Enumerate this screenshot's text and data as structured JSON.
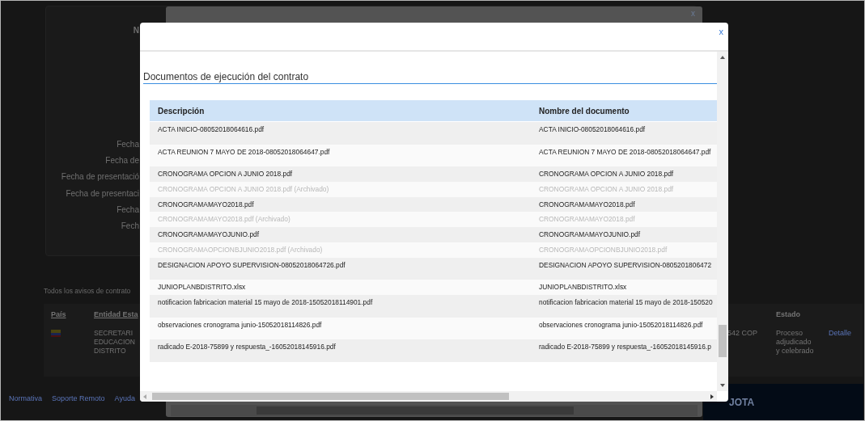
{
  "background_page": {
    "form_labels": [
      "N",
      "Fecha",
      "Fecha de",
      "Fecha de presentació",
      "Fecha de presentaci",
      "Fecha",
      "Fech"
    ],
    "notices_heading": "Todos los avisos de contrato",
    "results_table": {
      "column_1": "País",
      "column_2": "Entidad Esta",
      "status_header": "Estado",
      "row": {
        "entity_lines": [
          "SECRETARI",
          "EDUCACION",
          "DISTRITO"
        ],
        "value": "542 COP",
        "status": "Proceso adjudicado y celebrado",
        "link": "Detalle"
      }
    },
    "footer_links": [
      "Normativa",
      "Soporte Remoto",
      "Ayuda"
    ],
    "banner_text": "JOTA"
  },
  "back_dialog": {
    "close": "x"
  },
  "dialog": {
    "close": "x",
    "section_title": "Documentos de ejecución del contrato",
    "table": {
      "columns": [
        "Descripción",
        "Nombre del documento"
      ],
      "rows": [
        {
          "description": "ACTA INICIO-08052018064616.pdf",
          "document_name": "ACTA INICIO-08052018064616.pdf",
          "archived": false,
          "tall": true
        },
        {
          "description": "ACTA REUNION 7 MAYO DE 2018-08052018064647.pdf",
          "document_name": "ACTA REUNION 7 MAYO DE 2018-08052018064647.pdf",
          "archived": false,
          "tall": true
        },
        {
          "description": "CRONOGRAMA OPCION A JUNIO 2018.pdf",
          "document_name": "CRONOGRAMA OPCION A JUNIO 2018.pdf",
          "archived": false,
          "tall": false
        },
        {
          "description": "CRONOGRAMA OPCION A JUNIO 2018.pdf (Archivado)",
          "document_name": "CRONOGRAMA OPCION A JUNIO 2018.pdf",
          "archived": true,
          "tall": false
        },
        {
          "description": "CRONOGRAMAMAYO2018.pdf",
          "document_name": "CRONOGRAMAMAYO2018.pdf",
          "archived": false,
          "tall": false
        },
        {
          "description": "CRONOGRAMAMAYO2018.pdf (Archivado)",
          "document_name": "CRONOGRAMAMAYO2018.pdf",
          "archived": true,
          "tall": false
        },
        {
          "description": "CRONOGRAMAMAYOJUNIO.pdf",
          "document_name": "CRONOGRAMAMAYOJUNIO.pdf",
          "archived": false,
          "tall": false
        },
        {
          "description": "CRONOGRAMAOPCIONBJUNIO2018.pdf (Archivado)",
          "document_name": "CRONOGRAMAOPCIONBJUNIO2018.pdf",
          "archived": true,
          "tall": false
        },
        {
          "description": "DESIGNACION APOYO SUPERVISION-08052018064726.pdf",
          "document_name": "DESIGNACION APOYO SUPERVISION-0805201806472",
          "archived": false,
          "tall": true
        },
        {
          "description": "JUNIOPLANBDISTRITO.xlsx",
          "document_name": "JUNIOPLANBDISTRITO.xlsx",
          "archived": false,
          "tall": false
        },
        {
          "description": "notificacion fabricacion material 15 mayo de 2018-15052018114901.pdf",
          "document_name": "notificacion fabricacion material 15 mayo de 2018-150520",
          "archived": false,
          "tall": true
        },
        {
          "description": "observaciones cronograma junio-15052018114826.pdf",
          "document_name": "observaciones cronograma junio-15052018114826.pdf",
          "archived": false,
          "tall": true
        },
        {
          "description": "radicado E-2018-75899 y respuesta_-16052018145916.pdf",
          "document_name": "radicado E-2018-75899 y respuesta_-16052018145916.p",
          "archived": false,
          "tall": true
        }
      ]
    }
  }
}
